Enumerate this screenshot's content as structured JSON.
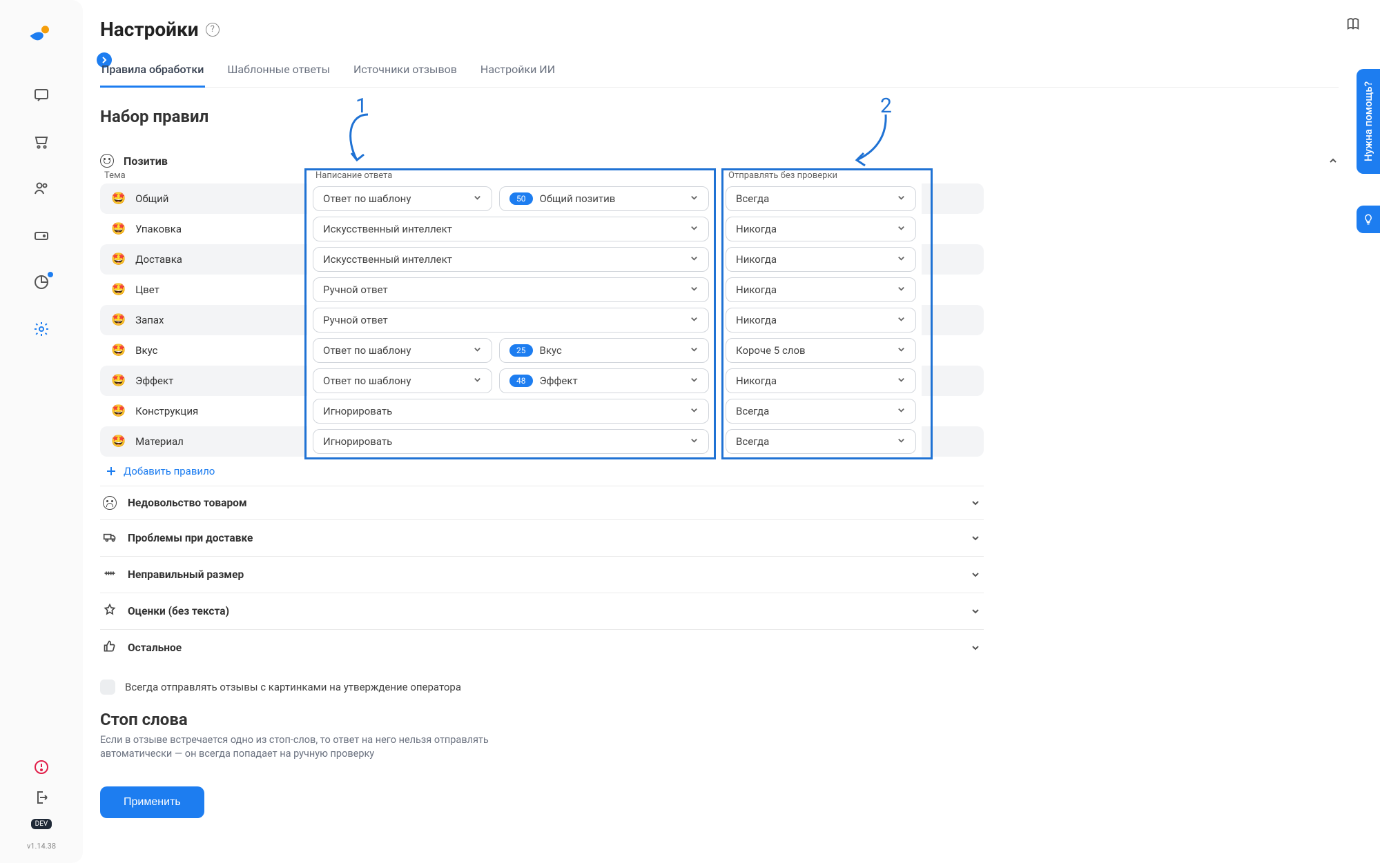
{
  "page": {
    "title": "Настройки"
  },
  "tabs": {
    "processing_rules": "Правила обработки",
    "template_replies": "Шаблонные ответы",
    "review_sources": "Источники отзывов",
    "ai_settings": "Настройки ИИ",
    "active_index": 0
  },
  "section_rules_title": "Набор правил",
  "annotations": {
    "one": "1",
    "two": "2"
  },
  "positive_group": {
    "title": "Позитив",
    "columns": {
      "topic": "Тема",
      "write": "Написание ответа",
      "send": "Отправлять без проверки"
    },
    "rows": [
      {
        "topic": "Общий",
        "write": "Ответ по шаблону",
        "template_count": 50,
        "template_name": "Общий позитив",
        "send": "Всегда"
      },
      {
        "topic": "Упаковка",
        "write": "Искусственный интеллект",
        "send": "Никогда"
      },
      {
        "topic": "Доставка",
        "write": "Искусственный интеллект",
        "send": "Никогда"
      },
      {
        "topic": "Цвет",
        "write": "Ручной ответ",
        "send": "Никогда"
      },
      {
        "topic": "Запах",
        "write": "Ручной ответ",
        "send": "Никогда"
      },
      {
        "topic": "Вкус",
        "write": "Ответ по шаблону",
        "template_count": 25,
        "template_name": "Вкус",
        "send": "Короче 5 слов"
      },
      {
        "topic": "Эффект",
        "write": "Ответ по шаблону",
        "template_count": 48,
        "template_name": "Эффект",
        "send": "Никогда"
      },
      {
        "topic": "Конструкция",
        "write": "Игнорировать",
        "send": "Всегда"
      },
      {
        "topic": "Материал",
        "write": "Игнорировать",
        "send": "Всегда"
      }
    ],
    "add_label": "Добавить правило"
  },
  "collapsed_groups": [
    {
      "icon": "sad",
      "title": "Недовольство товаром"
    },
    {
      "icon": "truck",
      "title": "Проблемы при доставке"
    },
    {
      "icon": "ruler",
      "title": "Неправильный размер"
    },
    {
      "icon": "star",
      "title": "Оценки (без текста)"
    },
    {
      "icon": "thumb",
      "title": "Остальное"
    }
  ],
  "checkbox_label": "Всегда отправлять отзывы с картинками на утверждение оператора",
  "stopwords": {
    "title": "Стоп слова",
    "desc": "Если в отзыве встречается одно из стоп-слов, то ответ на него нельзя отправлять автоматически — он всегда попадает на ручную проверку"
  },
  "apply_label": "Применить",
  "help_tab_label": "Нужна помощь?",
  "dev_badge": "DEV",
  "version": "v1.14.38"
}
